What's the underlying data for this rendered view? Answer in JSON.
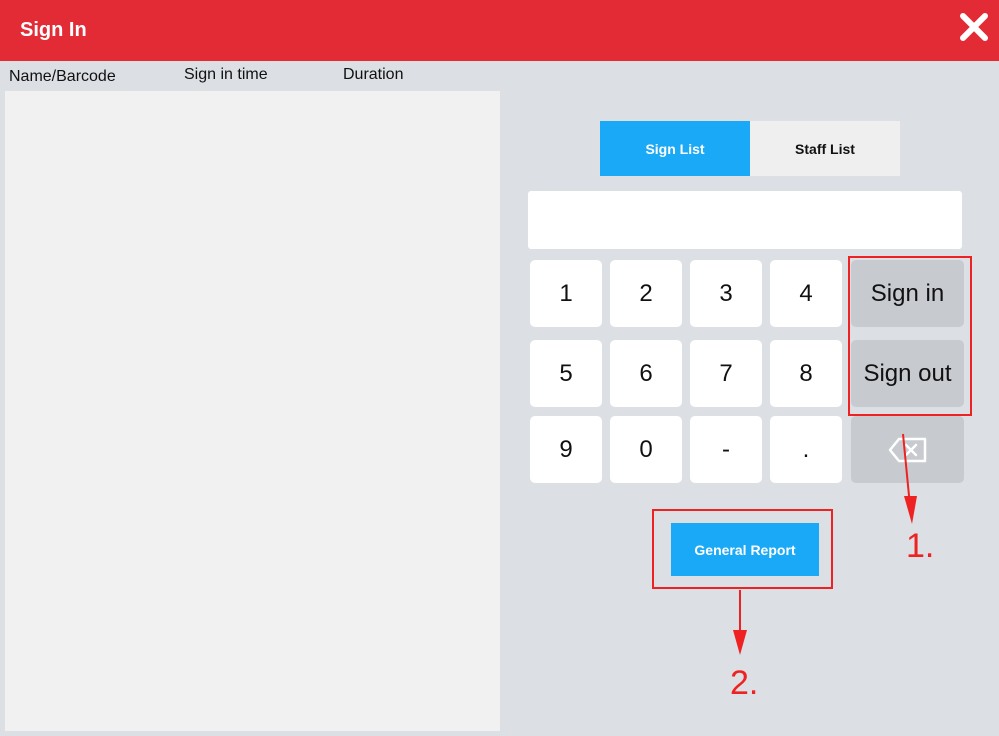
{
  "window": {
    "title": "Sign In"
  },
  "list": {
    "columns": [
      "Name/Barcode",
      "Sign in time",
      "Duration"
    ],
    "rows": []
  },
  "tabs": [
    {
      "label": "Sign List",
      "active": true
    },
    {
      "label": "Staff List",
      "active": false
    }
  ],
  "entry": {
    "value": "",
    "placeholder": ""
  },
  "keypad": {
    "keys": [
      "1",
      "2",
      "3",
      "4",
      "5",
      "6",
      "7",
      "8",
      "9",
      "0",
      "-",
      "."
    ]
  },
  "actions": {
    "sign_in": "Sign in",
    "sign_out": "Sign out",
    "backspace_icon": "backspace-icon"
  },
  "report": {
    "label": "General Report"
  },
  "annotations": {
    "label_1": "1.",
    "label_2": "2."
  },
  "colors": {
    "accent_red": "#e32b36",
    "accent_blue": "#1aa9f7",
    "annotation_red": "#ee2222",
    "background": "#dcdfe3"
  }
}
